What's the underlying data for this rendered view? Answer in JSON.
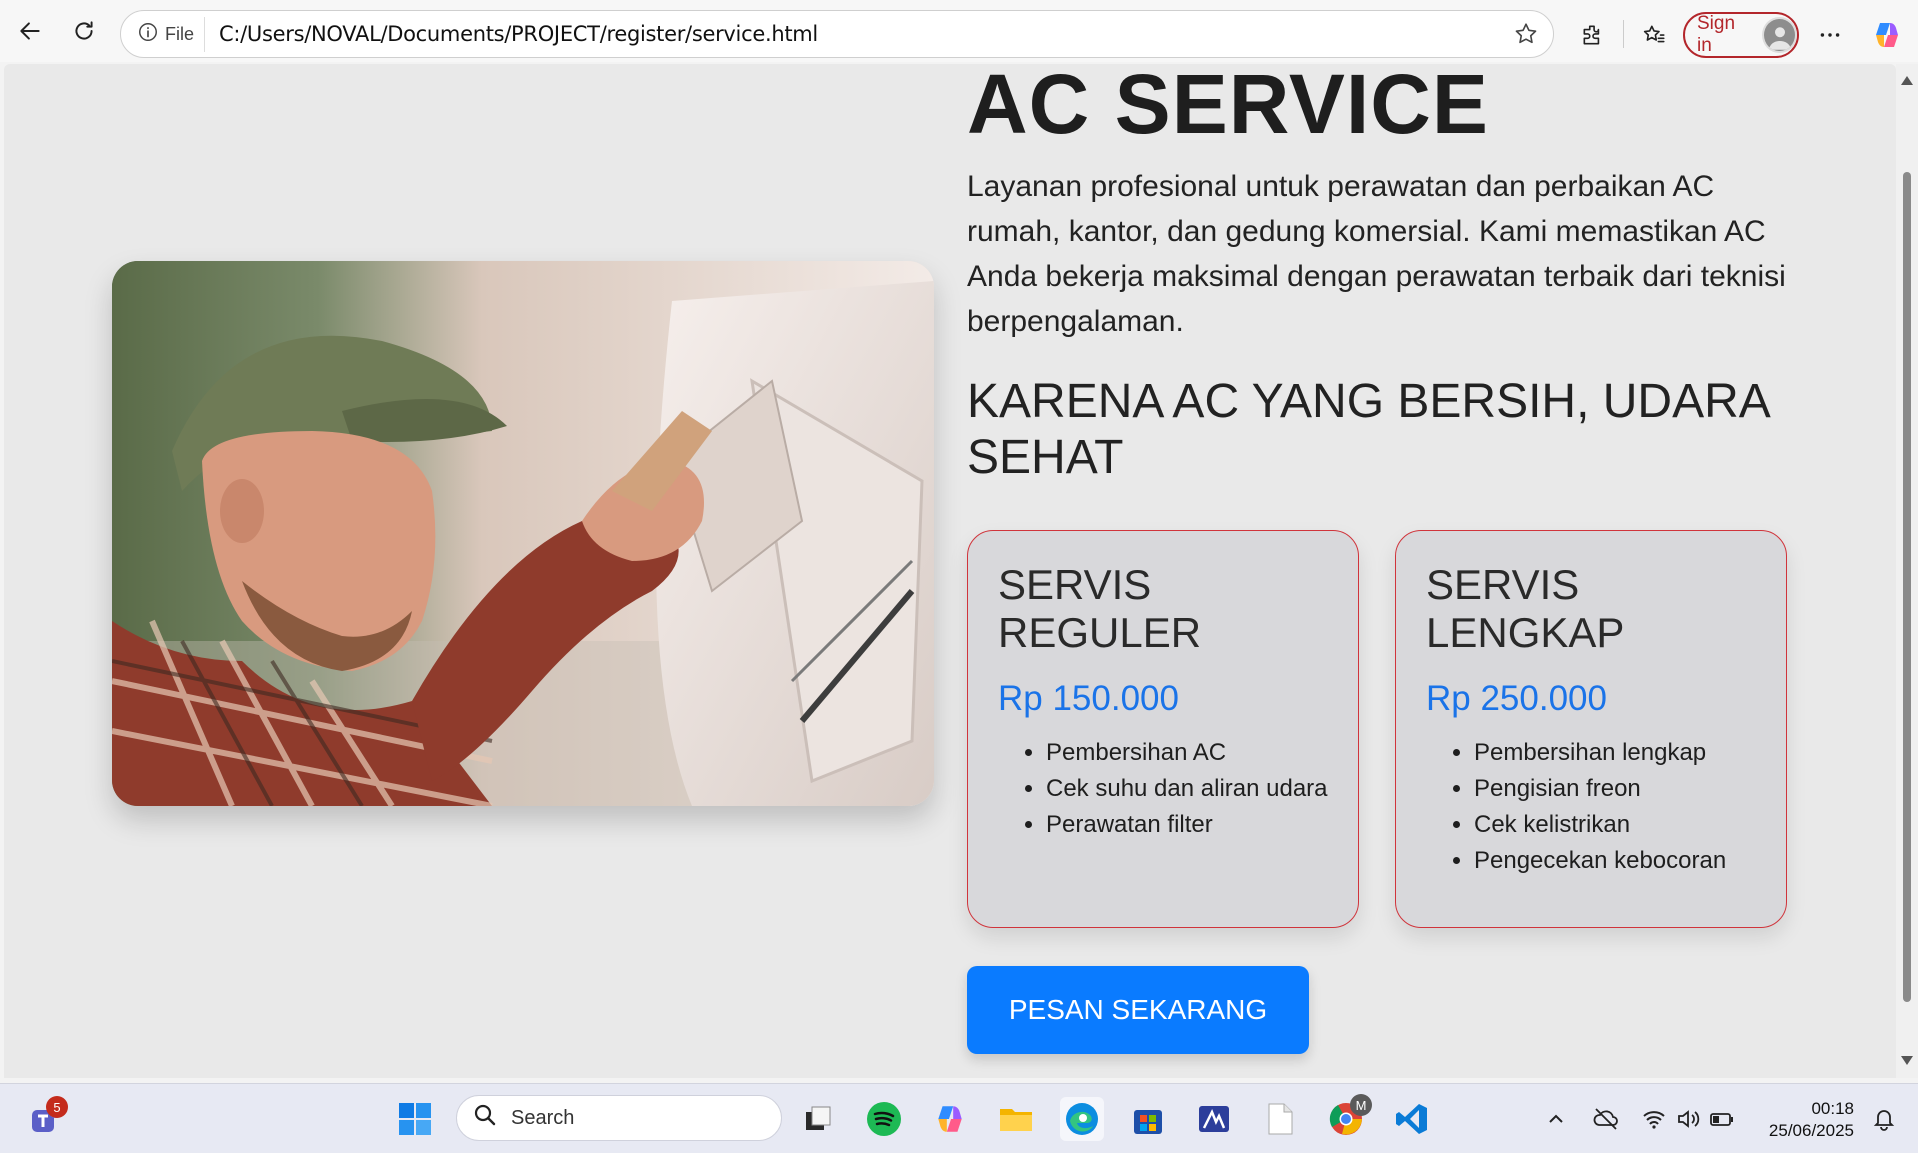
{
  "browser": {
    "file_label": "File",
    "url": "C:/Users/NOVAL/Documents/PROJECT/register/service.html",
    "signin_label": "Sign in"
  },
  "page": {
    "title": "AC SERVICE",
    "description": "Layanan profesional untuk perawatan dan perbaikan AC rumah, kantor, dan gedung komersial. Kami memastikan AC Anda bekerja maksimal dengan perawatan terbaik dari teknisi berpengalaman.",
    "subtitle": "KARENA AC YANG BERSIH, UDARA SEHAT",
    "cards": [
      {
        "title": "SERVIS REGULER",
        "price": "Rp 150.000",
        "features": [
          "Pembersihan AC",
          "Cek suhu dan aliran udara",
          "Perawatan filter"
        ]
      },
      {
        "title": "SERVIS LENGKAP",
        "price": "Rp 250.000",
        "features": [
          "Pembersihan lengkap",
          "Pengisian freon",
          "Cek kelistrikan",
          "Pengecekan kebocoran"
        ]
      }
    ],
    "cta_label": "PESAN SEKARANG"
  },
  "taskbar": {
    "search_placeholder": "Search",
    "time": "00:18",
    "date": "25/06/2025",
    "teams_badge": "5",
    "chrome_profile": "M"
  },
  "colors": {
    "accent_blue": "#0a7bff",
    "price_blue": "#1a73e8",
    "card_border": "#d0343b"
  }
}
